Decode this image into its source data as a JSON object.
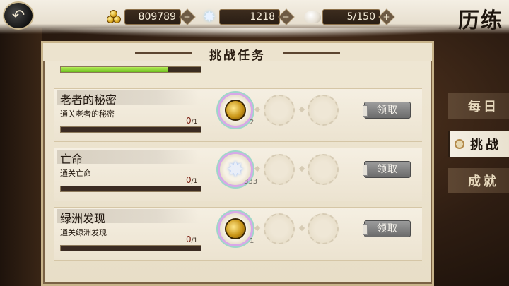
{
  "header": {
    "title": "历练",
    "back_icon": "back-arrow-icon",
    "currencies": [
      {
        "name": "gold",
        "icon": "gold-coins-icon",
        "value": "809789",
        "plus": "+"
      },
      {
        "name": "jade",
        "icon": "shuriken-star-icon",
        "value": "1218",
        "plus": "+"
      },
      {
        "name": "stamina",
        "icon": "steamed-bun-icon",
        "value": "5/150",
        "plus": "+"
      }
    ]
  },
  "panel": {
    "title": "挑战任务",
    "overall_progress": 0.77,
    "tasks": [
      {
        "name": "老者的秘密",
        "desc": "通关老者的秘密",
        "count": "0",
        "total": "/1",
        "reward_icon": "gold-coin-icon",
        "reward_qty": "2",
        "claim_label": "领取"
      },
      {
        "name": "亡命",
        "desc": "通关亡命",
        "count": "0",
        "total": "/1",
        "reward_icon": "shuriken-star-icon",
        "reward_qty": "333",
        "claim_label": "领取"
      },
      {
        "name": "绿洲发现",
        "desc": "通关绿洲发现",
        "count": "0",
        "total": "/1",
        "reward_icon": "gold-coin-icon",
        "reward_qty": "1",
        "claim_label": "领取"
      }
    ]
  },
  "tabs": [
    {
      "label": "每日",
      "active": false
    },
    {
      "label": "挑战",
      "active": true
    },
    {
      "label": "成就",
      "active": false
    }
  ]
}
